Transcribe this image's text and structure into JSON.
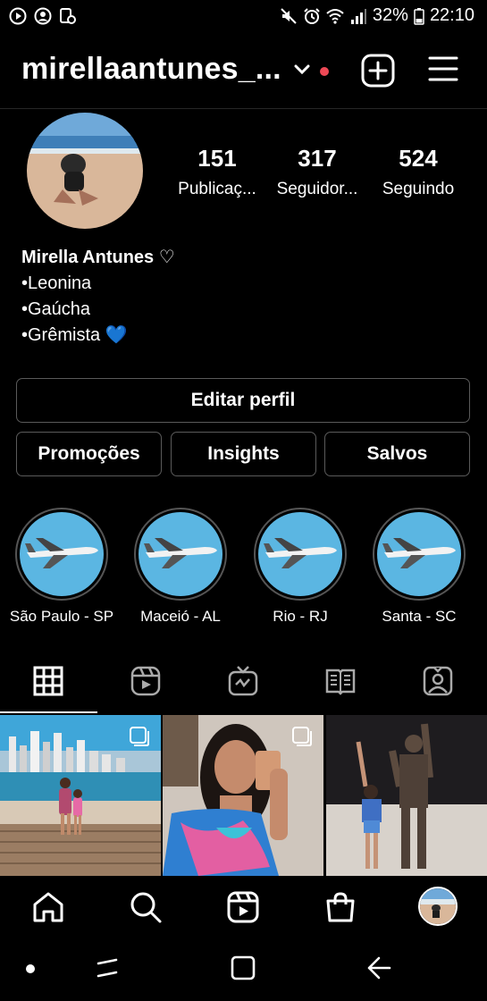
{
  "status_bar": {
    "battery": "32%",
    "time": "22:10"
  },
  "header": {
    "username": "mirellaantunes_..."
  },
  "profile": {
    "stats": [
      {
        "value": "151",
        "label": "Publicaç..."
      },
      {
        "value": "317",
        "label": "Seguidor..."
      },
      {
        "value": "524",
        "label": "Seguindo"
      }
    ],
    "name": "Mirella Antunes ♡",
    "bio_lines": [
      "•Leonina",
      "•Gaúcha",
      "•Grêmista  💙"
    ]
  },
  "buttons": {
    "edit_profile": "Editar perfil",
    "promotions": "Promoções",
    "insights": "Insights",
    "saved": "Salvos"
  },
  "highlights": [
    {
      "label": "São Paulo - SP"
    },
    {
      "label": "Maceió - AL"
    },
    {
      "label": "Rio - RJ"
    },
    {
      "label": "Santa - SC"
    }
  ],
  "tabs": [
    {
      "icon": "grid-icon"
    },
    {
      "icon": "reels-icon"
    },
    {
      "icon": "igtv-icon"
    },
    {
      "icon": "guides-icon"
    },
    {
      "icon": "tagged-icon"
    }
  ],
  "bottom_nav": [
    {
      "icon": "home-icon"
    },
    {
      "icon": "search-icon"
    },
    {
      "icon": "reels-icon"
    },
    {
      "icon": "shop-icon"
    },
    {
      "icon": "profile-avatar"
    }
  ],
  "colors": {
    "background": "#000000",
    "notification_dot": "#ed4956",
    "highlight_bg": "#5bb6e2"
  }
}
